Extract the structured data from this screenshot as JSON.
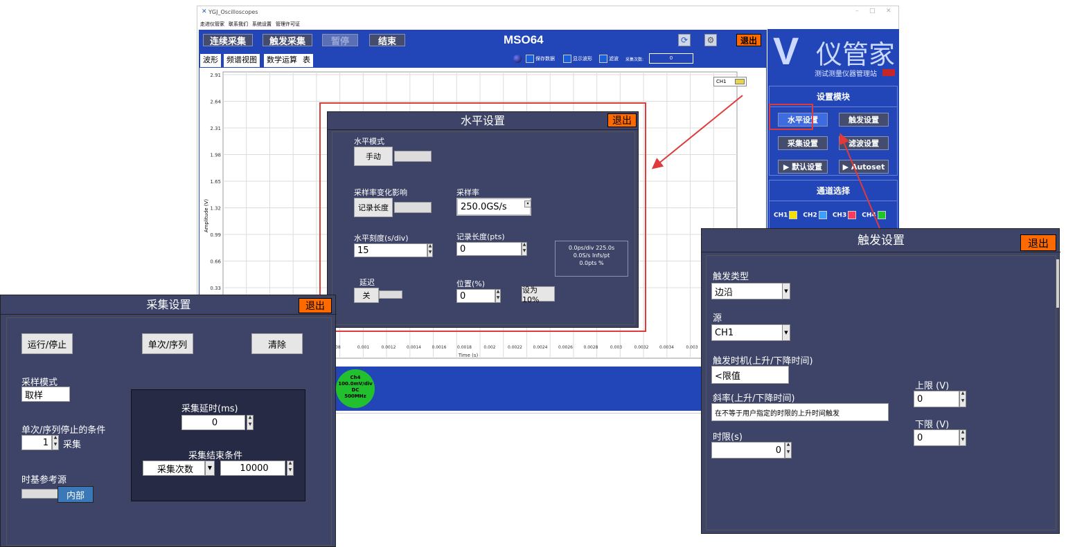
{
  "window": {
    "title": "YGJ_Oscilloscopes",
    "controls": [
      "–",
      "□",
      "✕"
    ]
  },
  "menu": [
    "走进仪管家",
    "联系我们",
    "系统设置",
    "管理许可证"
  ],
  "toolbar": {
    "continuous": "连续采集",
    "trigger_acq": "触发采集",
    "pause": "暂停",
    "end": "结束",
    "model": "MSO64",
    "exit": "退出"
  },
  "tabs": [
    "波形",
    "频谱视图",
    "数学运算",
    "表"
  ],
  "options": {
    "save_data": "保存数据",
    "show_wave": "显示波形",
    "filter": "滤波",
    "acq_count_label": "采集次数:",
    "acq_count_value": "0"
  },
  "chart_legend": "CH1",
  "logo": {
    "text": "仪管家",
    "subtitle": "测试测量仪器管理站"
  },
  "sidepanel": {
    "settings_header": "设置模块",
    "horizontal": "水平设置",
    "trigger": "触发设置",
    "acquire": "采集设置",
    "filter": "滤波设置",
    "default": "▶ 默认设置",
    "autoset": "▶ Autoset",
    "channel_header": "通道选择",
    "channels": [
      "CH1",
      "CH2",
      "CH3",
      "CH4"
    ],
    "channel_colors": [
      "#f2e200",
      "#3ba0ff",
      "#ff3b5c",
      "#21c42a"
    ]
  },
  "chart_data": {
    "type": "line",
    "ylabel": "Amplitude (V)",
    "xlabel": "Time (s)",
    "yticks": [
      "2.91",
      "2.64",
      "2.31",
      "1.98",
      "1.65",
      "1.32",
      "0.99",
      "0.66",
      "0.33"
    ],
    "xticks": [
      "08",
      "0.001",
      "0.0012",
      "0.0014",
      "0.0016",
      "0.0018",
      "0.002",
      "0.0022",
      "0.0024",
      "0.0026",
      "0.0028",
      "0.003",
      "0.0032",
      "0.0034",
      "0.003"
    ],
    "series": []
  },
  "ch4_badge": {
    "line1": "Ch4",
    "line2": "100.0mV/div",
    "line3": "DC",
    "line4": "500MHz"
  },
  "horizontal_dialog": {
    "title": "水平设置",
    "exit": "退出",
    "mode_label": "水平模式",
    "mode_button": "手动",
    "rate_effect_label": "采样率变化影响",
    "rate_effect_button": "记录长度",
    "sample_rate_label": "采样率",
    "sample_rate_value": "250.0GS/s",
    "scale_label": "水平刻度(s/div)",
    "scale_value": "15",
    "record_label": "记录长度(pts)",
    "record_value": "0",
    "info_line1": "0.0ps/div   225.0s",
    "info_line2": "0.0S/s   Infs/pt",
    "info_line3": "0.0pts      %",
    "delay_label": "延迟",
    "delay_button": "关",
    "position_label": "位置(%)",
    "position_value": "0",
    "set10_button": "设为10%"
  },
  "acquire_dialog": {
    "title": "采集设置",
    "exit": "退出",
    "run_stop": "运行/停止",
    "single_seq": "单次/序列",
    "clear": "清除",
    "mode_label": "采样模式",
    "mode_value": "取样",
    "stop_cond_label": "单次/序列停止的条件",
    "stop_cond_value": "1",
    "stop_cond_unit": "采集",
    "timebase_label": "时基参考源",
    "timebase_value": "内部",
    "delay_label": "采集延时(ms)",
    "delay_value": "0",
    "end_cond_label": "采集结束条件",
    "end_cond_select": "采集次数",
    "end_cond_value": "10000"
  },
  "trigger_dialog": {
    "title": "触发设置",
    "exit": "退出",
    "type_label": "触发类型",
    "type_value": "边沿",
    "source_label": "源",
    "source_value": "CH1",
    "timing_label": "触发时机(上升/下降时间)",
    "timing_value": "<限值",
    "slope_label": "斜率(上升/下降时间)",
    "slope_value": "在不等于用户指定的时限的上升时间触发",
    "time_label": "时限(s)",
    "time_value": "0",
    "upper_label": "上限 (V)",
    "upper_value": "0",
    "lower_label": "下限 (V)",
    "lower_value": "0"
  }
}
